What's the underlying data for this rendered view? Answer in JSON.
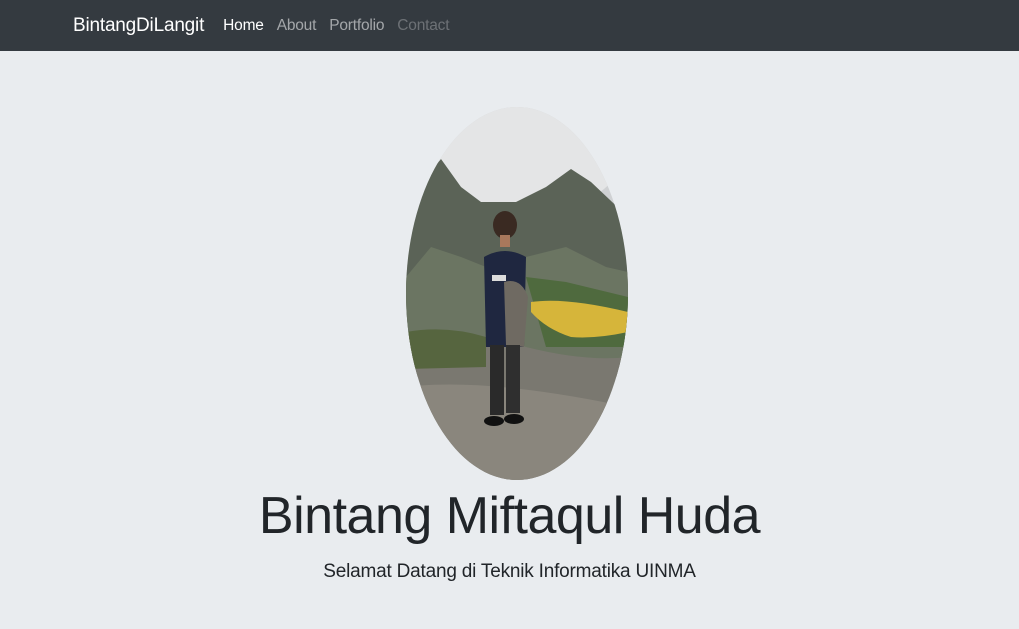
{
  "navbar": {
    "brand": "BintangDiLangit",
    "links": [
      {
        "label": "Home",
        "state": "active"
      },
      {
        "label": "About",
        "state": "normal"
      },
      {
        "label": "Portfolio",
        "state": "normal"
      },
      {
        "label": "Contact",
        "state": "disabled"
      }
    ]
  },
  "hero": {
    "photo_icon": "profile-photo",
    "name": "Bintang Miftaqul Huda",
    "tagline": "Selamat Datang di Teknik Informatika UINMA"
  },
  "colors": {
    "navbar_bg": "#343a40",
    "page_bg": "#e9ecef",
    "text": "#212529"
  }
}
